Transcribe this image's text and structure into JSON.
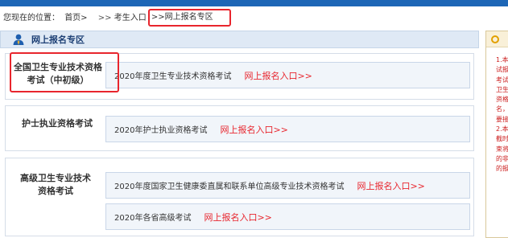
{
  "breadcrumb": {
    "prefix": "您现在的位置：",
    "home": "首页>",
    "sep1": ">>",
    "candidate": "考生入口",
    "sep2": ">>",
    "current": "网上报名专区"
  },
  "panel": {
    "title": "网上报名专区",
    "icon": "person-icon"
  },
  "categories": [
    {
      "label_lines": [
        "全国卫生专业技术资格",
        "考试（中初级）"
      ],
      "exams": [
        {
          "name": "2020年度卫生专业技术资格考试",
          "link": "网上报名入口>>"
        }
      ]
    },
    {
      "label_lines": [
        "护士执业资格考试"
      ],
      "exams": [
        {
          "name": "2020年护士执业资格考试",
          "link": "网上报名入口>>"
        }
      ]
    },
    {
      "label_lines": [
        "高级卫生专业技术",
        "资格考试"
      ],
      "exams": [
        {
          "name": "2020年度国家卫生健康委直属和联系单位高级专业技术资格考试",
          "link": "网上报名入口>>"
        },
        {
          "name": "2020年各省高级考试",
          "link": "网上报名入口>>"
        }
      ]
    }
  ],
  "side_panel": {
    "icon": "circle-icon",
    "lines": [
      "1.本",
      "试报",
      "考试",
      "卫生",
      "资格",
      "名，",
      "要接",
      "2.本",
      "截时",
      "束将",
      "的非",
      "的报"
    ]
  },
  "colors": {
    "topbar": "#1d66b6",
    "link": "#e8252d",
    "highlight": "#e8252d",
    "panel_head": "#dfe9f5"
  }
}
